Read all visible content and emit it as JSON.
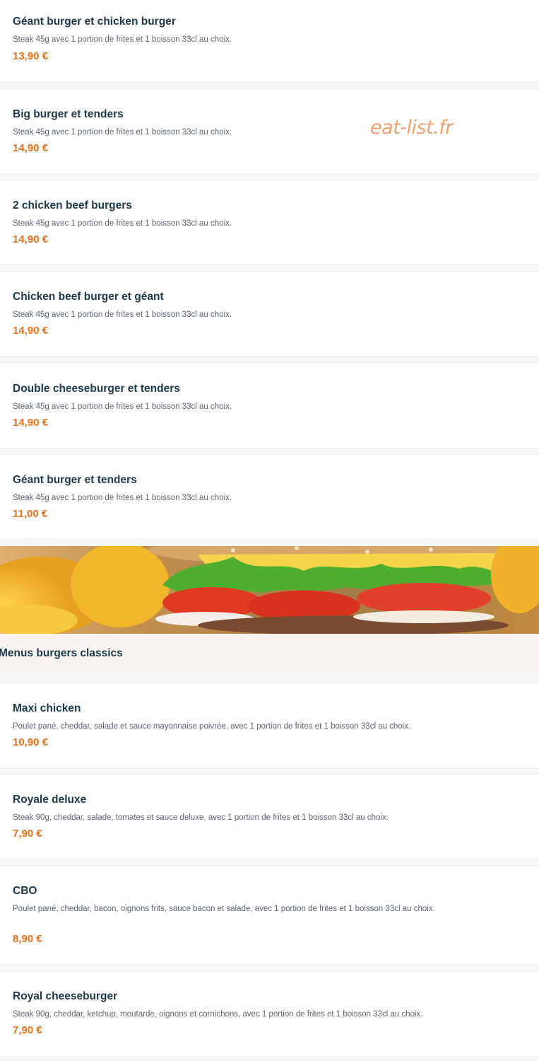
{
  "watermark": "eat-list.fr",
  "section_menus_burgers_classics": "Menus burgers classics",
  "banner_image": "burger-photo",
  "colors": {
    "title": "#1d3a4a",
    "price": "#e8731e",
    "description": "#5c6670",
    "watermark": "#f0a070"
  },
  "items": [
    {
      "name": "Géant burger et chicken burger",
      "description": "Steak 45g avec 1 portion de frites et 1 boisson 33cl au choix.",
      "price": "13,90 €"
    },
    {
      "name": "Big burger et tenders",
      "description": "Steak 45g avec 1 portion de frites et 1 boisson 33cl au choix.",
      "price": "14,90 €"
    },
    {
      "name": "2 chicken beef burgers",
      "description": "Steak 45g avec 1 portion de frites et 1 boisson 33cl au choix.",
      "price": "14,90 €"
    },
    {
      "name": "Chicken beef burger et géant",
      "description": "Steak 45g avec 1 portion de frites et 1 boisson 33cl au choix.",
      "price": "14,90 €"
    },
    {
      "name": "Double cheeseburger et tenders",
      "description": "Steak 45g avec 1 portion de frites et 1 boisson 33cl au choix.",
      "price": "14,90 €"
    },
    {
      "name": "Géant burger et tenders",
      "description": "Steak 45g avec 1 portion de frites et 1 boisson 33cl au choix.",
      "price": "11,00 €"
    },
    {
      "name": "Maxi chicken",
      "description": "Poulet pané, cheddar, salade et sauce mayonnaise poivrée, avec 1 portion de frites et 1 boisson 33cl au choix.",
      "price": "10,90 €"
    },
    {
      "name": "Royale deluxe",
      "description": "Steak 90g, cheddar, salade, tomates et sauce deluxe, avec 1 portion de frites et 1 boisson 33cl au choix.",
      "price": "7,90 €"
    },
    {
      "name": "CBO",
      "description": "Poulet pané, cheddar, bacon, oignons frits, sauce bacon et salade, avec 1 portion de frites et 1 boisson 33cl au choix.",
      "price": "8,90 €"
    },
    {
      "name": "Royal cheeseburger",
      "description": "Steak 90g, cheddar, ketchup, moutarde, oignons et cornichons, avec 1 portion de frites et 1 boisson 33cl au choix.",
      "price": "7,90 €"
    }
  ]
}
